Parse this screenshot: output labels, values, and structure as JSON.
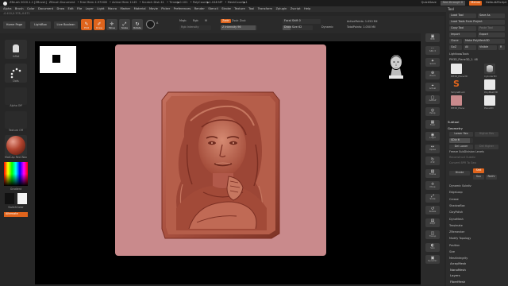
{
  "titlebar": {
    "items": [
      "ZBrush 2020.1.1 [ZBrush]",
      "ZBrush Document",
      "• Free Mem 4.970GB",
      "• Active Mem 1145",
      "• Scratch Disk 41",
      "• Timer▶0.101",
      "• PolyCount▶1.048 MP",
      "• MeshCount▶1"
    ],
    "quicksave": "QuickSave",
    "seethrough": "See-through 0",
    "menus_label": "Menus",
    "script": "DefaultZScript"
  },
  "menubar": {
    "items": [
      "Alpha",
      "Brush",
      "Color",
      "Document",
      "Draw",
      "Edit",
      "File",
      "Layer",
      "Light",
      "Macro",
      "Marker",
      "Material",
      "Movie",
      "Picker",
      "Preferences",
      "Render",
      "Stencil",
      "Stroke",
      "Texture",
      "Tool",
      "Transform",
      "Zplugin",
      "Zscript",
      "Help"
    ]
  },
  "status": "-0.410,0.378,-0.871",
  "toolbar": {
    "home_page": "Home Page",
    "lightbox": "LightBox",
    "live_boolean": "Live Boolean",
    "edit": "Edit",
    "draw": "Draw",
    "move": "Move",
    "scale": "Scale",
    "rotate": "Rotate",
    "a_label": "A",
    "mrgb": "Mrgb",
    "rgb": "Rgb",
    "m": "M",
    "rgb_intensity": "Rgb Intensity",
    "zadd": "Zadd",
    "zsub": "Zsub",
    "zcut": "Zcut",
    "z_intensity": "Z Intensity 96",
    "z_intensity_value": 0.96,
    "focal_shift": "Focal Shift 0",
    "draw_size": "Draw Size 62",
    "draw_size_value": 0.25,
    "dynamic": "Dynamic",
    "active_points": "ActivePoints: 1.050 Mil",
    "total_points": "TotalPoints: 1.050 Mil"
  },
  "leftshelf": {
    "items": [
      "Inflat",
      "Dots",
      "Alpha Off",
      "Texture Off",
      "MatCap Red Wax",
      "Gradient",
      "SwitchColor",
      "Alternate"
    ]
  },
  "rightcol": {
    "buttons": [
      {
        "glyph": "▣",
        "label": "BPR"
      },
      {
        "glyph": "⋯",
        "label": "SPix 3"
      },
      {
        "glyph": "✦",
        "label": "Scroll"
      },
      {
        "glyph": "⊕",
        "label": "Zoom"
      },
      {
        "glyph": "⌖",
        "label": "Actual"
      },
      {
        "glyph": "▢",
        "label": "AAHalf"
      },
      {
        "glyph": "◎",
        "label": "Persp"
      },
      {
        "glyph": "▦",
        "label": "Floor"
      },
      {
        "glyph": "◉",
        "label": "L.Sym"
      },
      {
        "glyph": "↔",
        "label": "Xpose"
      },
      {
        "glyph": "↻",
        "label": "XYZ"
      },
      {
        "glyph": "▧",
        "label": "Frame"
      },
      {
        "glyph": "✛",
        "label": "Move"
      },
      {
        "glyph": "⤢",
        "label": "Scale"
      },
      {
        "glyph": "↺",
        "label": "Rotate"
      },
      {
        "glyph": "▤",
        "label": "PolyF"
      },
      {
        "glyph": "◫",
        "label": "Transp"
      },
      {
        "glyph": "◐",
        "label": "Solo"
      },
      {
        "glyph": "▣",
        "label": "Dynamic"
      }
    ]
  },
  "toolpanel": {
    "title": "Tool",
    "load_tool": "Load Tool",
    "save_as": "Save As",
    "load_from_project": "Load Tools From Project",
    "copy_tool": "Copy Tool",
    "paste_tool": "Paste Tool",
    "import": "Import",
    "export": "Export",
    "clone": "Clone",
    "make_polymesh": "Make PolyMesh3D",
    "goz": "GoZ",
    "all": "All",
    "visible": "Visible",
    "r": "R",
    "lightbox_tools": "Lightbox▸Tools",
    "current_tool": "PM3D_Plane3D_1. 48",
    "thumbs": [
      {
        "label": "PM3D_Plane3D"
      },
      {
        "label": "Cylinder3D"
      },
      {
        "label": "SimpleBrush"
      },
      {
        "label": "PolyMesh3D"
      },
      {
        "label": "PM3D_Plane"
      },
      {
        "label": "Plane3D"
      }
    ],
    "subtool": "Subtool",
    "geometry": "Geometry",
    "lower_res": "Lower Res",
    "higher_res": "Higher Res",
    "sdiv": "SDiv 6",
    "sdiv_value": 0.86,
    "del_lower": "Del Lower",
    "del_higher": "Del Higher",
    "freeze_subdiv": "Freeze SubDivision Levels",
    "reconstruct": "Reconstruct Subdiv",
    "convert_bpr": "Convert BPR To Geo",
    "divide": "Divide",
    "smt": "Smt",
    "suv": "Suv",
    "reuv": "ReUV",
    "geometry_items": [
      "Dynamic Subdiv",
      "EdgeLoop",
      "Crease",
      "ShadowBox",
      "ClayPolish",
      "DynaMesh",
      "Tessimate",
      "ZRemesher",
      "Modify Topology",
      "Position",
      "Size",
      "MeshIntegrity"
    ],
    "bottom_items": [
      "ArrayMesh",
      "NanoMesh",
      "Layers",
      "FiberMesh"
    ]
  },
  "canvas_colors": {
    "background": "#000000",
    "document": "#c9888a",
    "relief": "#b0584a",
    "accent": "#e0641c"
  }
}
